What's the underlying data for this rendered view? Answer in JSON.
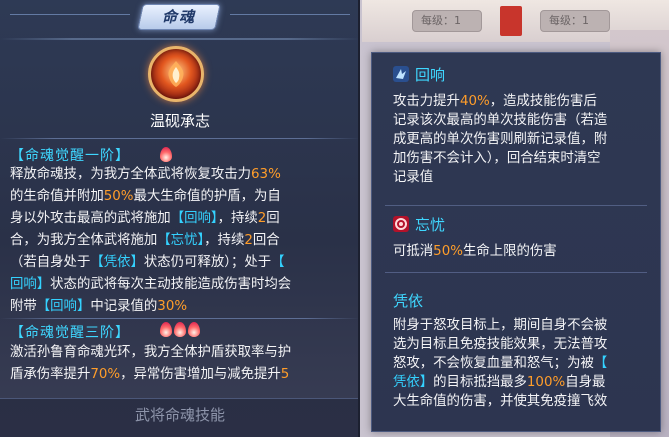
{
  "header_tag": "命魂",
  "skill_name": "温砚承志",
  "stage1": {
    "title": "【命魂觉醒一阶】",
    "lines": [
      [
        "释放命魂技，为我方全体武将恢复攻击力",
        "63%"
      ],
      [
        "的生命值并附加",
        "50%",
        "最大生命值的护盾，为自"
      ],
      [
        "身以外攻击最高的武将施加",
        "【回响】",
        "，持续",
        "2",
        "回"
      ],
      [
        "合，为我方全体武将施加",
        "【忘忧】",
        "，持续",
        "2",
        "回合"
      ],
      [
        "（若自身处于",
        "【凭依】",
        "状态仍可释放）；处于",
        "【"
      ],
      [
        "回响",
        "】",
        "状态的武将每次主动技能造成伤害时均会"
      ],
      [
        "附带",
        "【回响】",
        "中记录值的",
        "30%"
      ]
    ]
  },
  "stage3": {
    "title": "【命魂觉醒三阶】",
    "lines": [
      [
        "激活孙鲁育命魂光环，我方全体护盾获取率与护"
      ],
      [
        "盾承伤率提升",
        "70%",
        "，异常伤害增加与减免提升",
        "5"
      ]
    ]
  },
  "bottom_label": "武将命魂技能",
  "background": {
    "pill1": "每级：1",
    "pill2": "每级：1"
  },
  "effects": {
    "huixiang": {
      "title": "回响",
      "lines": [
        [
          "攻击力提升",
          "40%",
          "，造成技能伤害后"
        ],
        [
          "记录该次最高的单次技能伤害（若造"
        ],
        [
          "成更高的单次伤害则刷新记录值，附"
        ],
        [
          "加伤害不会计入），回合结束时清空"
        ],
        [
          "记录值"
        ]
      ]
    },
    "wangyou": {
      "title": "忘忧",
      "lines": [
        [
          "可抵消",
          "50%",
          "生命上限的伤害"
        ]
      ]
    },
    "pingyi": {
      "title": "凭依",
      "lines": [
        [
          "附身于怒攻目标上，期间自身不会被"
        ],
        [
          "选为目标且免疫技能效果，无法普攻"
        ],
        [
          "怒攻，不会恢复血量和怒气；为被",
          "【"
        ],
        [
          "凭依",
          "】",
          "的目标抵挡最多",
          "100%",
          "自身最"
        ],
        [
          "大生命值的伤害，并使其免疫撞飞效"
        ]
      ]
    }
  },
  "colors": {
    "highlight": "#ff9d2a",
    "tag_ref": "#34d2ff",
    "title": "#3fd7ff"
  }
}
